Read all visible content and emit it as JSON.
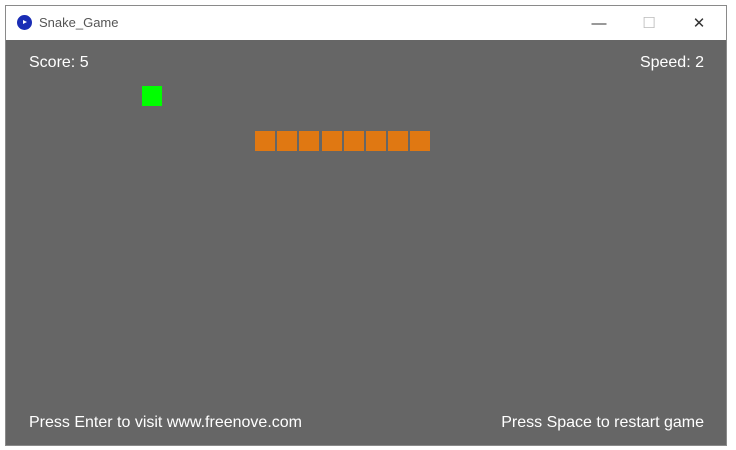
{
  "window": {
    "title": "Snake_Game",
    "minimize_label": "—",
    "maximize_label": "☐",
    "close_label": "✕"
  },
  "hud": {
    "score": "Score: 5",
    "speed": "Speed: 2"
  },
  "footer": {
    "left": "Press Enter to visit www.freenove.com",
    "right": "Press Space to restart game"
  },
  "colors": {
    "background": "#666666",
    "snake": "#e07812",
    "food": "#00ff00"
  },
  "snake_segments": 8
}
